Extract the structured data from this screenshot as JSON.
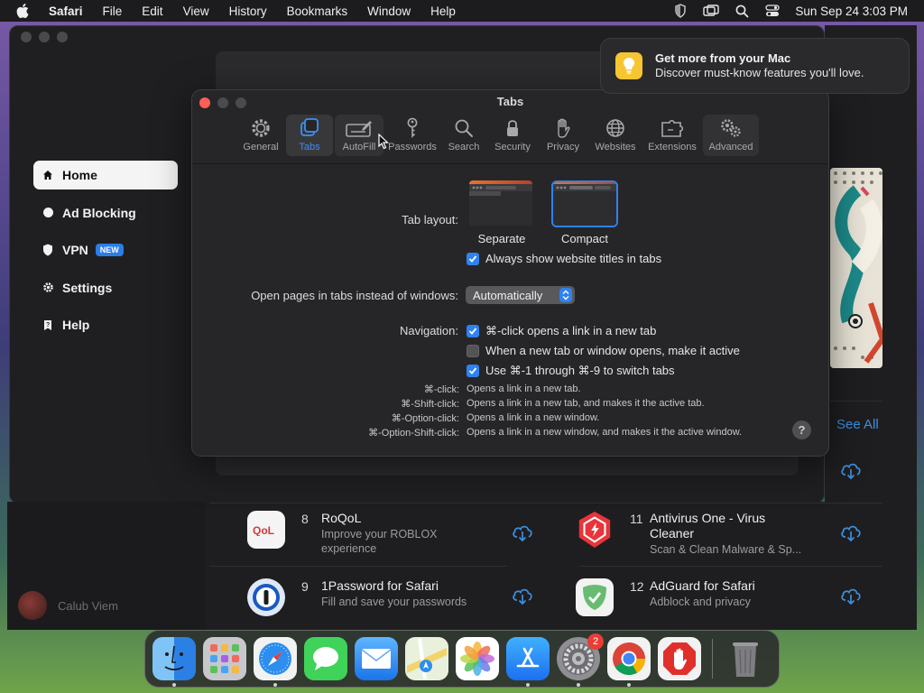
{
  "menubar": {
    "app": "Safari",
    "items": [
      "File",
      "Edit",
      "View",
      "History",
      "Bookmarks",
      "Window",
      "Help"
    ],
    "clock": "Sun Sep 24  3:03 PM"
  },
  "notification": {
    "title": "Get more from your Mac",
    "body": "Discover must-know features you'll love."
  },
  "sidebar": {
    "items": [
      {
        "label": "Home",
        "icon": "house-icon",
        "active": true
      },
      {
        "label": "Ad Blocking",
        "icon": "dot-icon"
      },
      {
        "label": "VPN",
        "icon": "shield-icon",
        "badge": "NEW"
      },
      {
        "label": "Settings",
        "icon": "gear-icon"
      },
      {
        "label": "Help",
        "icon": "question-icon"
      }
    ],
    "user": "Calub Viem"
  },
  "store": {
    "see_all": "See All",
    "apps": [
      {
        "num": "8",
        "name": "RoQoL",
        "sub": "Improve your ROBLOX experience",
        "sub2": "experience"
      },
      {
        "num": "9",
        "name": "1Password for Safari",
        "sub": "Fill and save your passwords"
      },
      {
        "num": "11",
        "name": "Antivirus One - Virus",
        "name2": "Cleaner",
        "sub": "Scan & Clean Malware & Sp..."
      },
      {
        "num": "12",
        "name": "AdGuard for Safari",
        "sub": "Adblock and privacy"
      }
    ]
  },
  "dialog": {
    "title": "Tabs",
    "tabs": [
      "General",
      "Tabs",
      "AutoFill",
      "Passwords",
      "Search",
      "Security",
      "Privacy",
      "Websites",
      "Extensions",
      "Advanced"
    ],
    "tab_layout_label": "Tab layout:",
    "layout_separate": "Separate",
    "layout_compact": "Compact",
    "always_show_titles": "Always show website titles in tabs",
    "open_pages_label": "Open pages in tabs instead of windows:",
    "open_pages_value": "Automatically",
    "navigation_label": "Navigation:",
    "nav_opt1": "⌘-click opens a link in a new tab",
    "nav_opt2": "When a new tab or window opens, make it active",
    "nav_opt3": "Use ⌘-1 through ⌘-9 to switch tabs",
    "shortcuts": [
      {
        "key": "⌘-click:",
        "desc": "Opens a link in a new tab."
      },
      {
        "key": "⌘-Shift-click:",
        "desc": "Opens a link in a new tab, and makes it the active tab."
      },
      {
        "key": "⌘-Option-click:",
        "desc": "Opens a link in a new window."
      },
      {
        "key": "⌘-Option-Shift-click:",
        "desc": "Opens a link in a new window, and makes it the active window."
      }
    ],
    "help": "?"
  },
  "dock": {
    "settings_badge": "2"
  },
  "colors": {
    "accent": "#2f82f0",
    "close": "#ff5f57",
    "dialog_bg": "#262628"
  }
}
